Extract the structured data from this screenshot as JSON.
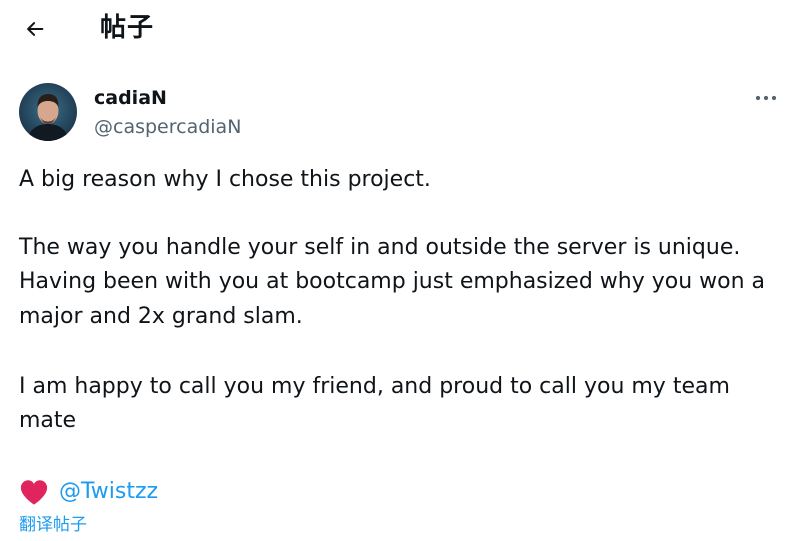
{
  "header": {
    "title": "帖子",
    "back_icon": "arrow-left-icon"
  },
  "author": {
    "name": "cadiaN",
    "handle": "@caspercadiaN",
    "avatar_icon": "avatar"
  },
  "menu_icon": "more-horizontal-icon",
  "post": {
    "line1": "A big reason why I chose this project.",
    "line2": "The way you handle your self in and outside the server is unique.",
    "line3": "Having been with you at bootcamp just emphasized why you won a",
    "line4": "major and 2x grand slam.",
    "line5": "I am happy to call you my friend, and proud to call you my team",
    "line6": "mate"
  },
  "mention": {
    "emoji_icon": "heart-icon",
    "heart_color": "#e0245e",
    "text": "@Twistzz"
  },
  "translate_label": "翻译帖子",
  "colors": {
    "text": "#0f1419",
    "secondary": "#536471",
    "link": "#1d9bf0"
  }
}
